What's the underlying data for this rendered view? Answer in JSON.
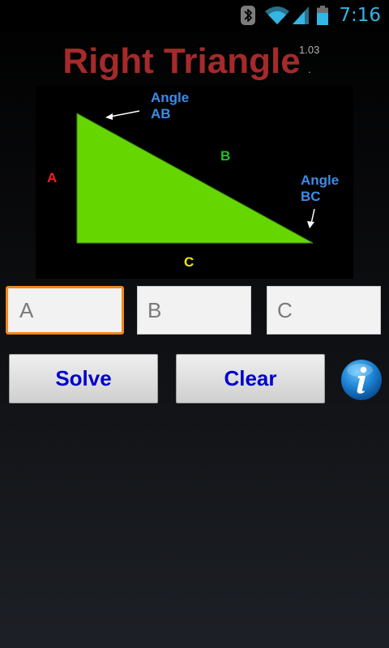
{
  "status_bar": {
    "time": "7:16",
    "icons": [
      "bluetooth-icon",
      "wifi-icon",
      "cell-signal-icon",
      "battery-icon"
    ],
    "accent_color": "#33b5e5"
  },
  "app": {
    "title": "Right Triangle",
    "version": "1.03",
    "version_dot": ".",
    "title_color": "#a52a2a"
  },
  "diagram": {
    "labels": {
      "side_a": "A",
      "side_b": "B",
      "side_c": "C",
      "angle_ab": "Angle\nAB",
      "angle_bc": "Angle\nBC"
    },
    "colors": {
      "triangle_fill": "#66d600",
      "side_a": "#ff1a1a",
      "side_b": "#1fbf2a",
      "side_c": "#f2e600",
      "angle_labels": "#3c8ce8"
    }
  },
  "inputs": {
    "a": {
      "placeholder": "A",
      "value": ""
    },
    "b": {
      "placeholder": "B",
      "value": ""
    },
    "c": {
      "placeholder": "C",
      "value": ""
    },
    "focused_border_color": "#f08a1c"
  },
  "buttons": {
    "solve_label": "Solve",
    "clear_label": "Clear",
    "label_color": "#0000cc",
    "info_icon": "info-icon"
  }
}
